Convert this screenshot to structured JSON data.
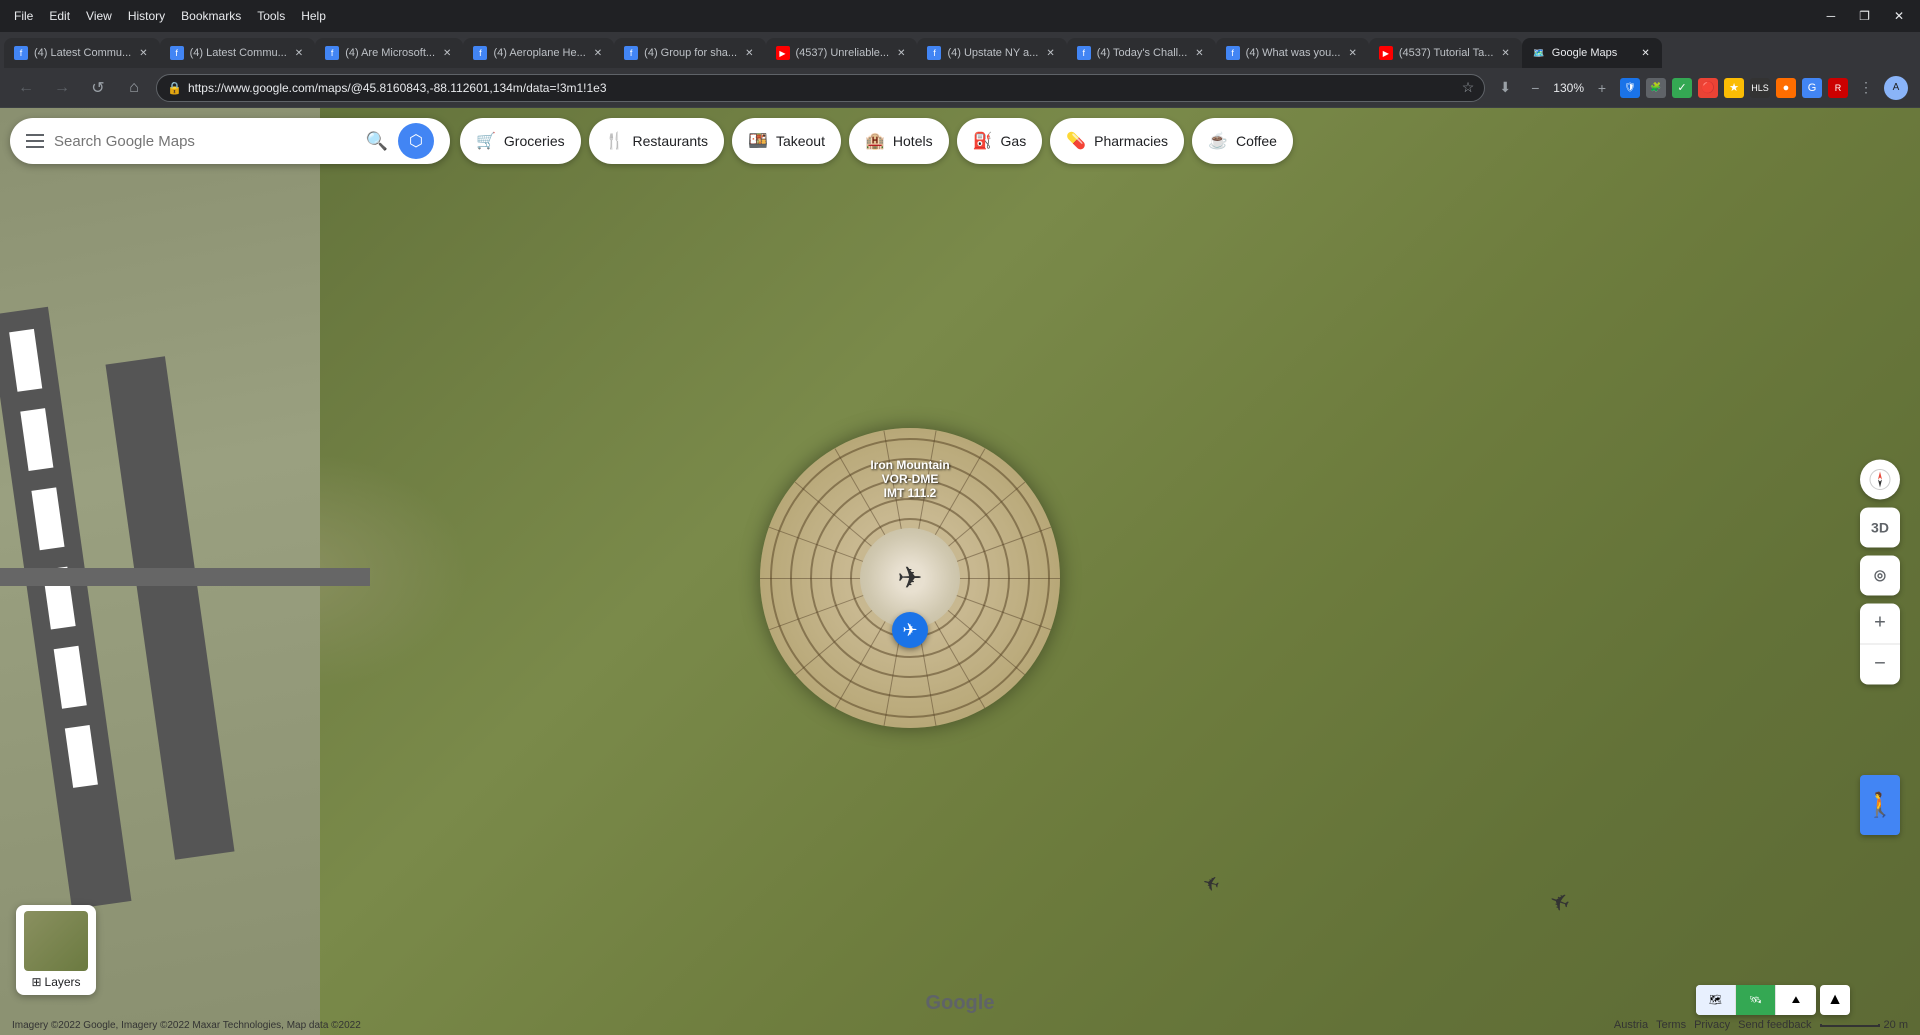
{
  "browser": {
    "menu_items": [
      "File",
      "Edit",
      "View",
      "History",
      "Bookmarks",
      "Tools",
      "Help"
    ],
    "window_buttons": [
      "─",
      "❐",
      "✕"
    ],
    "tabs": [
      {
        "id": "tab1",
        "title": "(4) Latest Commu...",
        "favicon_type": "generic",
        "active": false
      },
      {
        "id": "tab2",
        "title": "(4) Latest Commu...",
        "favicon_type": "generic",
        "active": false
      },
      {
        "id": "tab3",
        "title": "(4) Are Microsoft...",
        "favicon_type": "generic",
        "active": false
      },
      {
        "id": "tab4",
        "title": "(4) Aeroplane He...",
        "favicon_type": "generic",
        "active": false
      },
      {
        "id": "tab5",
        "title": "(4) Group for sha...",
        "favicon_type": "generic",
        "active": false
      },
      {
        "id": "tab6",
        "title": "(4537) Unreliable...",
        "favicon_type": "youtube",
        "active": false
      },
      {
        "id": "tab7",
        "title": "(4) Upstate NY a...",
        "favicon_type": "generic",
        "active": false
      },
      {
        "id": "tab8",
        "title": "(4) Today's Chall...",
        "favicon_type": "generic",
        "active": false
      },
      {
        "id": "tab9",
        "title": "(4) What was you...",
        "favicon_type": "generic",
        "active": false
      },
      {
        "id": "tab10",
        "title": "(4537) Tutorial Ta...",
        "favicon_type": "youtube",
        "active": false
      },
      {
        "id": "tab11",
        "title": "Google Maps",
        "favicon_type": "maps",
        "active": true
      }
    ],
    "url": "https://www.google.com/maps/@45.8160843,-88.112601,134m/data=!3m1!1e3",
    "zoom": "130%"
  },
  "maps": {
    "search_placeholder": "Search Google Maps",
    "categories": [
      {
        "id": "groceries",
        "label": "Groceries",
        "icon": "🛒"
      },
      {
        "id": "restaurants",
        "label": "Restaurants",
        "icon": "🍴"
      },
      {
        "id": "takeout",
        "label": "Takeout",
        "icon": "🍱"
      },
      {
        "id": "hotels",
        "label": "Hotels",
        "icon": "🏨"
      },
      {
        "id": "gas",
        "label": "Gas",
        "icon": "⛽"
      },
      {
        "id": "pharmacies",
        "label": "Pharmacies",
        "icon": "💊"
      },
      {
        "id": "coffee",
        "label": "Coffee",
        "icon": "☕"
      }
    ],
    "vor_label_line1": "Iron Mountain",
    "vor_label_line2": "VOR-DME",
    "vor_label_line3": "IMT 111.2",
    "footer_copyright": "Imagery ©2022 Google, Imagery ©2022 Maxar Technologies, Map data ©2022",
    "footer_region": "Austria",
    "footer_links": [
      "Terms",
      "Privacy",
      "Send feedback"
    ],
    "scale": "20 m",
    "google_logo": "Google",
    "controls": {
      "zoom_in": "+",
      "zoom_out": "−",
      "layers_label": "Layers",
      "three_d": "3D"
    }
  }
}
